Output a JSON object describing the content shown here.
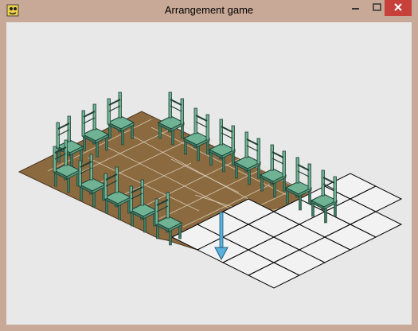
{
  "window": {
    "title": "Arrangement game",
    "icons": {
      "app": "pygame-snake-icon",
      "minimize": "minimize-icon",
      "maximize": "maximize-icon",
      "close": "close-icon"
    }
  },
  "colors": {
    "titlebar": "#c8a896",
    "client_bg": "#e8e8e8",
    "floor": "#8b6a40",
    "floor_lines": "#e6dcc8",
    "chair_body": "#6fb394",
    "chair_outline": "#1f3d33",
    "grid_line": "#000000",
    "empty_tile": "#f2f2f2",
    "arrow": "#5bb0dc",
    "close_button": "#c7403a"
  },
  "scene": {
    "chairs_back_row": 10,
    "chairs_front_row": 5,
    "cursor": "down-arrow"
  }
}
